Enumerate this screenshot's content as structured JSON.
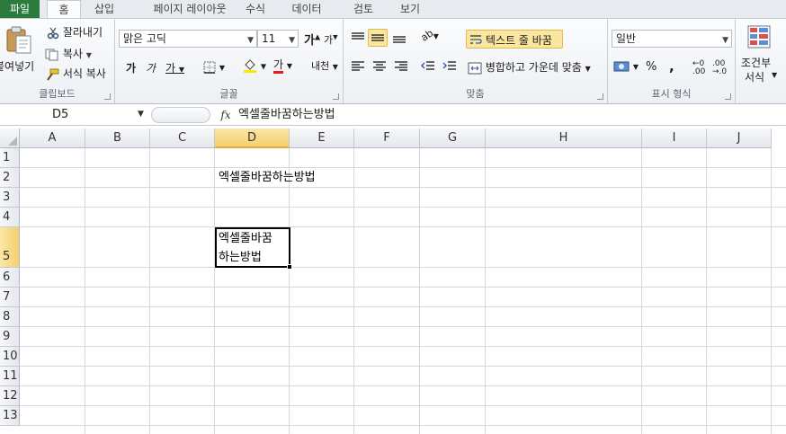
{
  "tabs": [
    "파일",
    "홈",
    "삽입",
    "페이지 레이아웃",
    "수식",
    "데이터",
    "검토",
    "보기"
  ],
  "ribbon": {
    "clipboard": {
      "paste": "붙여넣기",
      "cut": "잘라내기",
      "copy": "복사",
      "format_painter": "서식 복사",
      "label": "클립보드"
    },
    "font": {
      "name": "맑은 고딕",
      "size": "11",
      "grow": "가",
      "shrink": "가",
      "bold": "가",
      "italic": "가",
      "underline": "가",
      "font_color": "가",
      "phonetic": "내천",
      "label": "글꼴"
    },
    "alignment": {
      "wrap_text": "텍스트 줄 바꿈",
      "merge_center": "병합하고 가운데 맞춤",
      "label": "맞춤"
    },
    "number": {
      "format": "일반",
      "percent": "%",
      "comma": ",",
      "label": "표시 형식"
    },
    "styles": {
      "conditional": "조건부",
      "conditional2": "서식"
    }
  },
  "formula_bar": {
    "name_box": "D5",
    "fx": "fx",
    "content": "엑셀줄바꿈하는방법"
  },
  "grid": {
    "columns": [
      "A",
      "B",
      "C",
      "D",
      "E",
      "F",
      "G",
      "H",
      "I",
      "J"
    ],
    "rows": [
      "1",
      "2",
      "3",
      "4",
      "5",
      "6",
      "7",
      "8",
      "9",
      "10",
      "11",
      "12",
      "13"
    ],
    "selected_cell": "D5",
    "cells": {
      "D2": "엑셀줄바꿈하는방법",
      "D5_line1": "엑셀줄바꿈",
      "D5_line2": "하는방법"
    }
  },
  "colors": {
    "file_tab": "#2a7b3d",
    "selection_header": "#f5cf6c",
    "wrap_highlight": "#fbe6a0",
    "font_color_underline": "#e21b1b",
    "fill_color": "#ffe600"
  }
}
